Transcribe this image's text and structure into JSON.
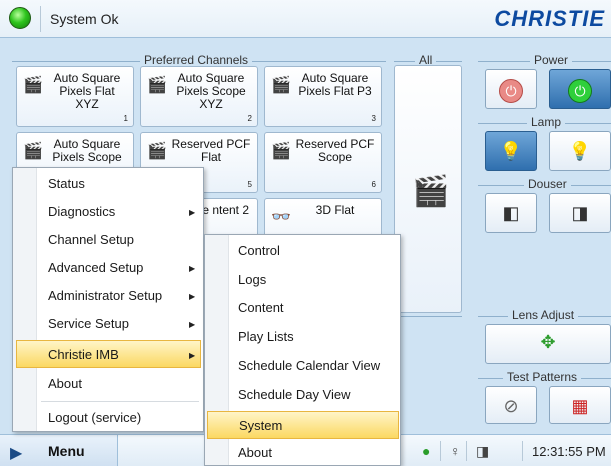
{
  "header": {
    "status": "System Ok",
    "brand": "CHRISTIE"
  },
  "groups": {
    "preferred": "Preferred Channels",
    "all": "All",
    "power": "Power",
    "lamp": "Lamp",
    "douser": "Douser",
    "lens": "Lens Adjust",
    "test": "Test Patterns"
  },
  "channels": [
    {
      "label": "Auto Square Pixels Flat XYZ",
      "num": "1"
    },
    {
      "label": "Auto Square Pixels Scope XYZ",
      "num": "2"
    },
    {
      "label": "Auto Square Pixels Flat P3",
      "num": "3"
    },
    {
      "label": "Auto Square Pixels Scope",
      "num": ""
    },
    {
      "label": "Reserved PCF Flat",
      "num": "5"
    },
    {
      "label": "Reserved PCF Scope",
      "num": "6"
    },
    {
      "label": "rnative ntent 2",
      "num": ""
    },
    {
      "label": "3D Flat",
      "num": ""
    }
  ],
  "main_menu": [
    "Status",
    "Diagnostics",
    "Channel Setup",
    "Advanced Setup",
    "Administrator Setup",
    "Service Setup",
    "Christie IMB",
    "About",
    "Logout (service)"
  ],
  "submenu": [
    "Control",
    "Logs",
    "Content",
    "Play Lists",
    "Schedule Calendar View",
    "Schedule Day View",
    "System",
    "About"
  ],
  "taskbar": {
    "menu_label": "Menu",
    "clock": "12:31:55 PM"
  },
  "colors": {
    "accent": "#2f6fae",
    "highlight": "#fbd862",
    "brand": "#0d4aa0"
  }
}
